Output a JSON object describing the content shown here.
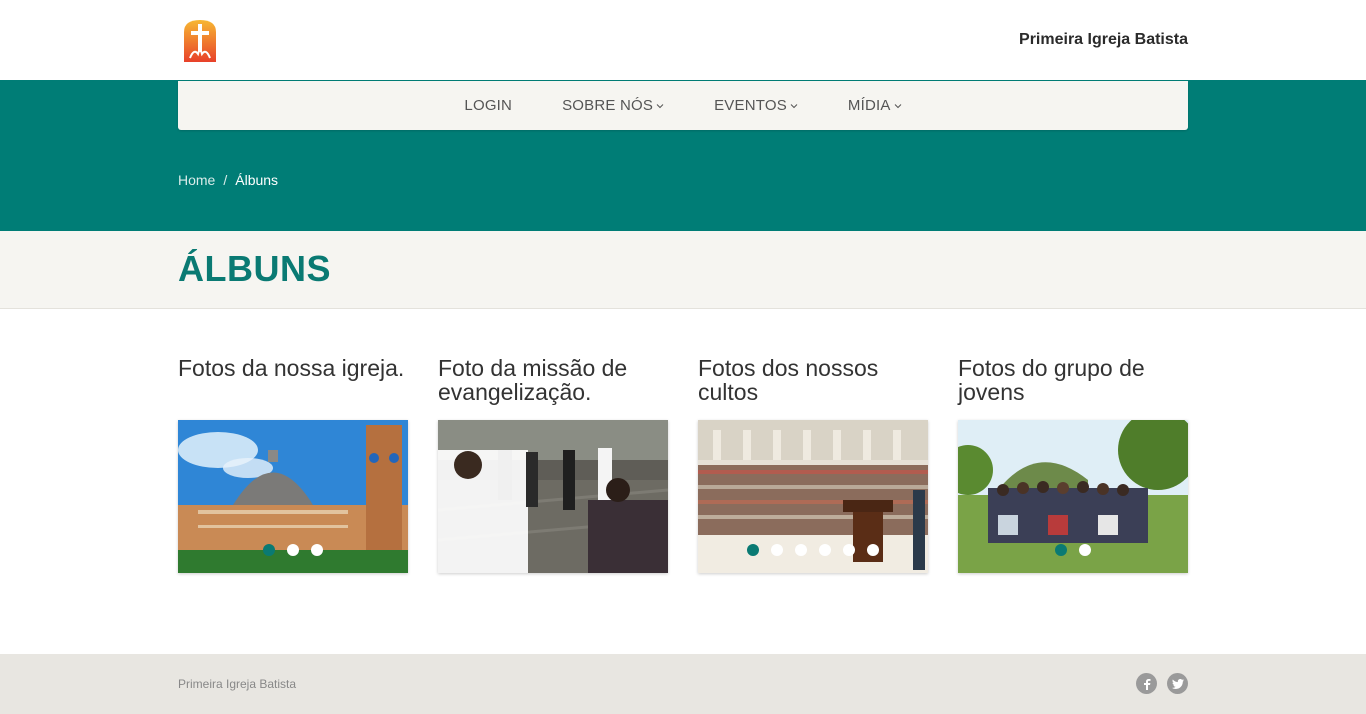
{
  "header": {
    "site_title": "Primeira Igreja Batista",
    "logo_icon": "church-cross-logo-icon"
  },
  "nav": {
    "items": [
      {
        "label": "LOGIN",
        "has_dropdown": false
      },
      {
        "label": "SOBRE NÓS",
        "has_dropdown": true
      },
      {
        "label": "EVENTOS",
        "has_dropdown": true
      },
      {
        "label": "MÍDIA",
        "has_dropdown": true
      }
    ]
  },
  "breadcrumb": {
    "home": "Home",
    "separator": "/",
    "current": "Álbuns"
  },
  "page": {
    "title": "ÁLBUNS"
  },
  "albums": [
    {
      "title": "Fotos da nossa igreja.",
      "dots": 3,
      "active_dot": 0
    },
    {
      "title": "Foto da missão de evangelização.",
      "dots": 0,
      "active_dot": -1
    },
    {
      "title": "Fotos dos nossos cultos",
      "dots": 6,
      "active_dot": 0
    },
    {
      "title": "Fotos do grupo de jovens",
      "dots": 2,
      "active_dot": 0
    }
  ],
  "footer": {
    "text": "Primeira Igreja Batista",
    "social": [
      "facebook-icon",
      "twitter-icon"
    ]
  },
  "colors": {
    "teal": "#007d76",
    "title_teal": "#0a7a73",
    "nav_bg": "#f6f5f1",
    "footer_bg": "#e8e6e1"
  }
}
